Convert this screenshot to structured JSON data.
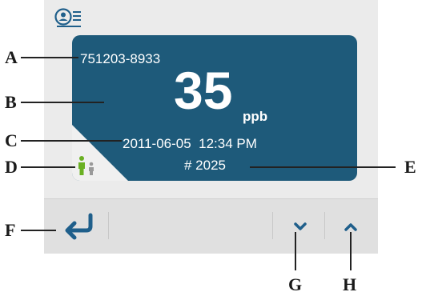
{
  "reading": {
    "patient_id": "751203-8933",
    "value": "35",
    "unit": "ppb",
    "datetime": "2011-06-05  12:34 PM",
    "test_number": "# 2025"
  },
  "icons": {
    "profile": "profile-list-icon",
    "persons": "adult-child-icon",
    "back": "back-arrow-icon",
    "down": "chevron-down-icon",
    "up": "chevron-up-icon"
  },
  "colors": {
    "card": "#1e5a7a",
    "icon_blue": "#1f5f8b",
    "person_green": "#6ab023"
  },
  "callouts": {
    "a": "A",
    "b": "B",
    "c": "C",
    "d": "D",
    "e": "E",
    "f": "F",
    "g": "G",
    "h": "H"
  }
}
